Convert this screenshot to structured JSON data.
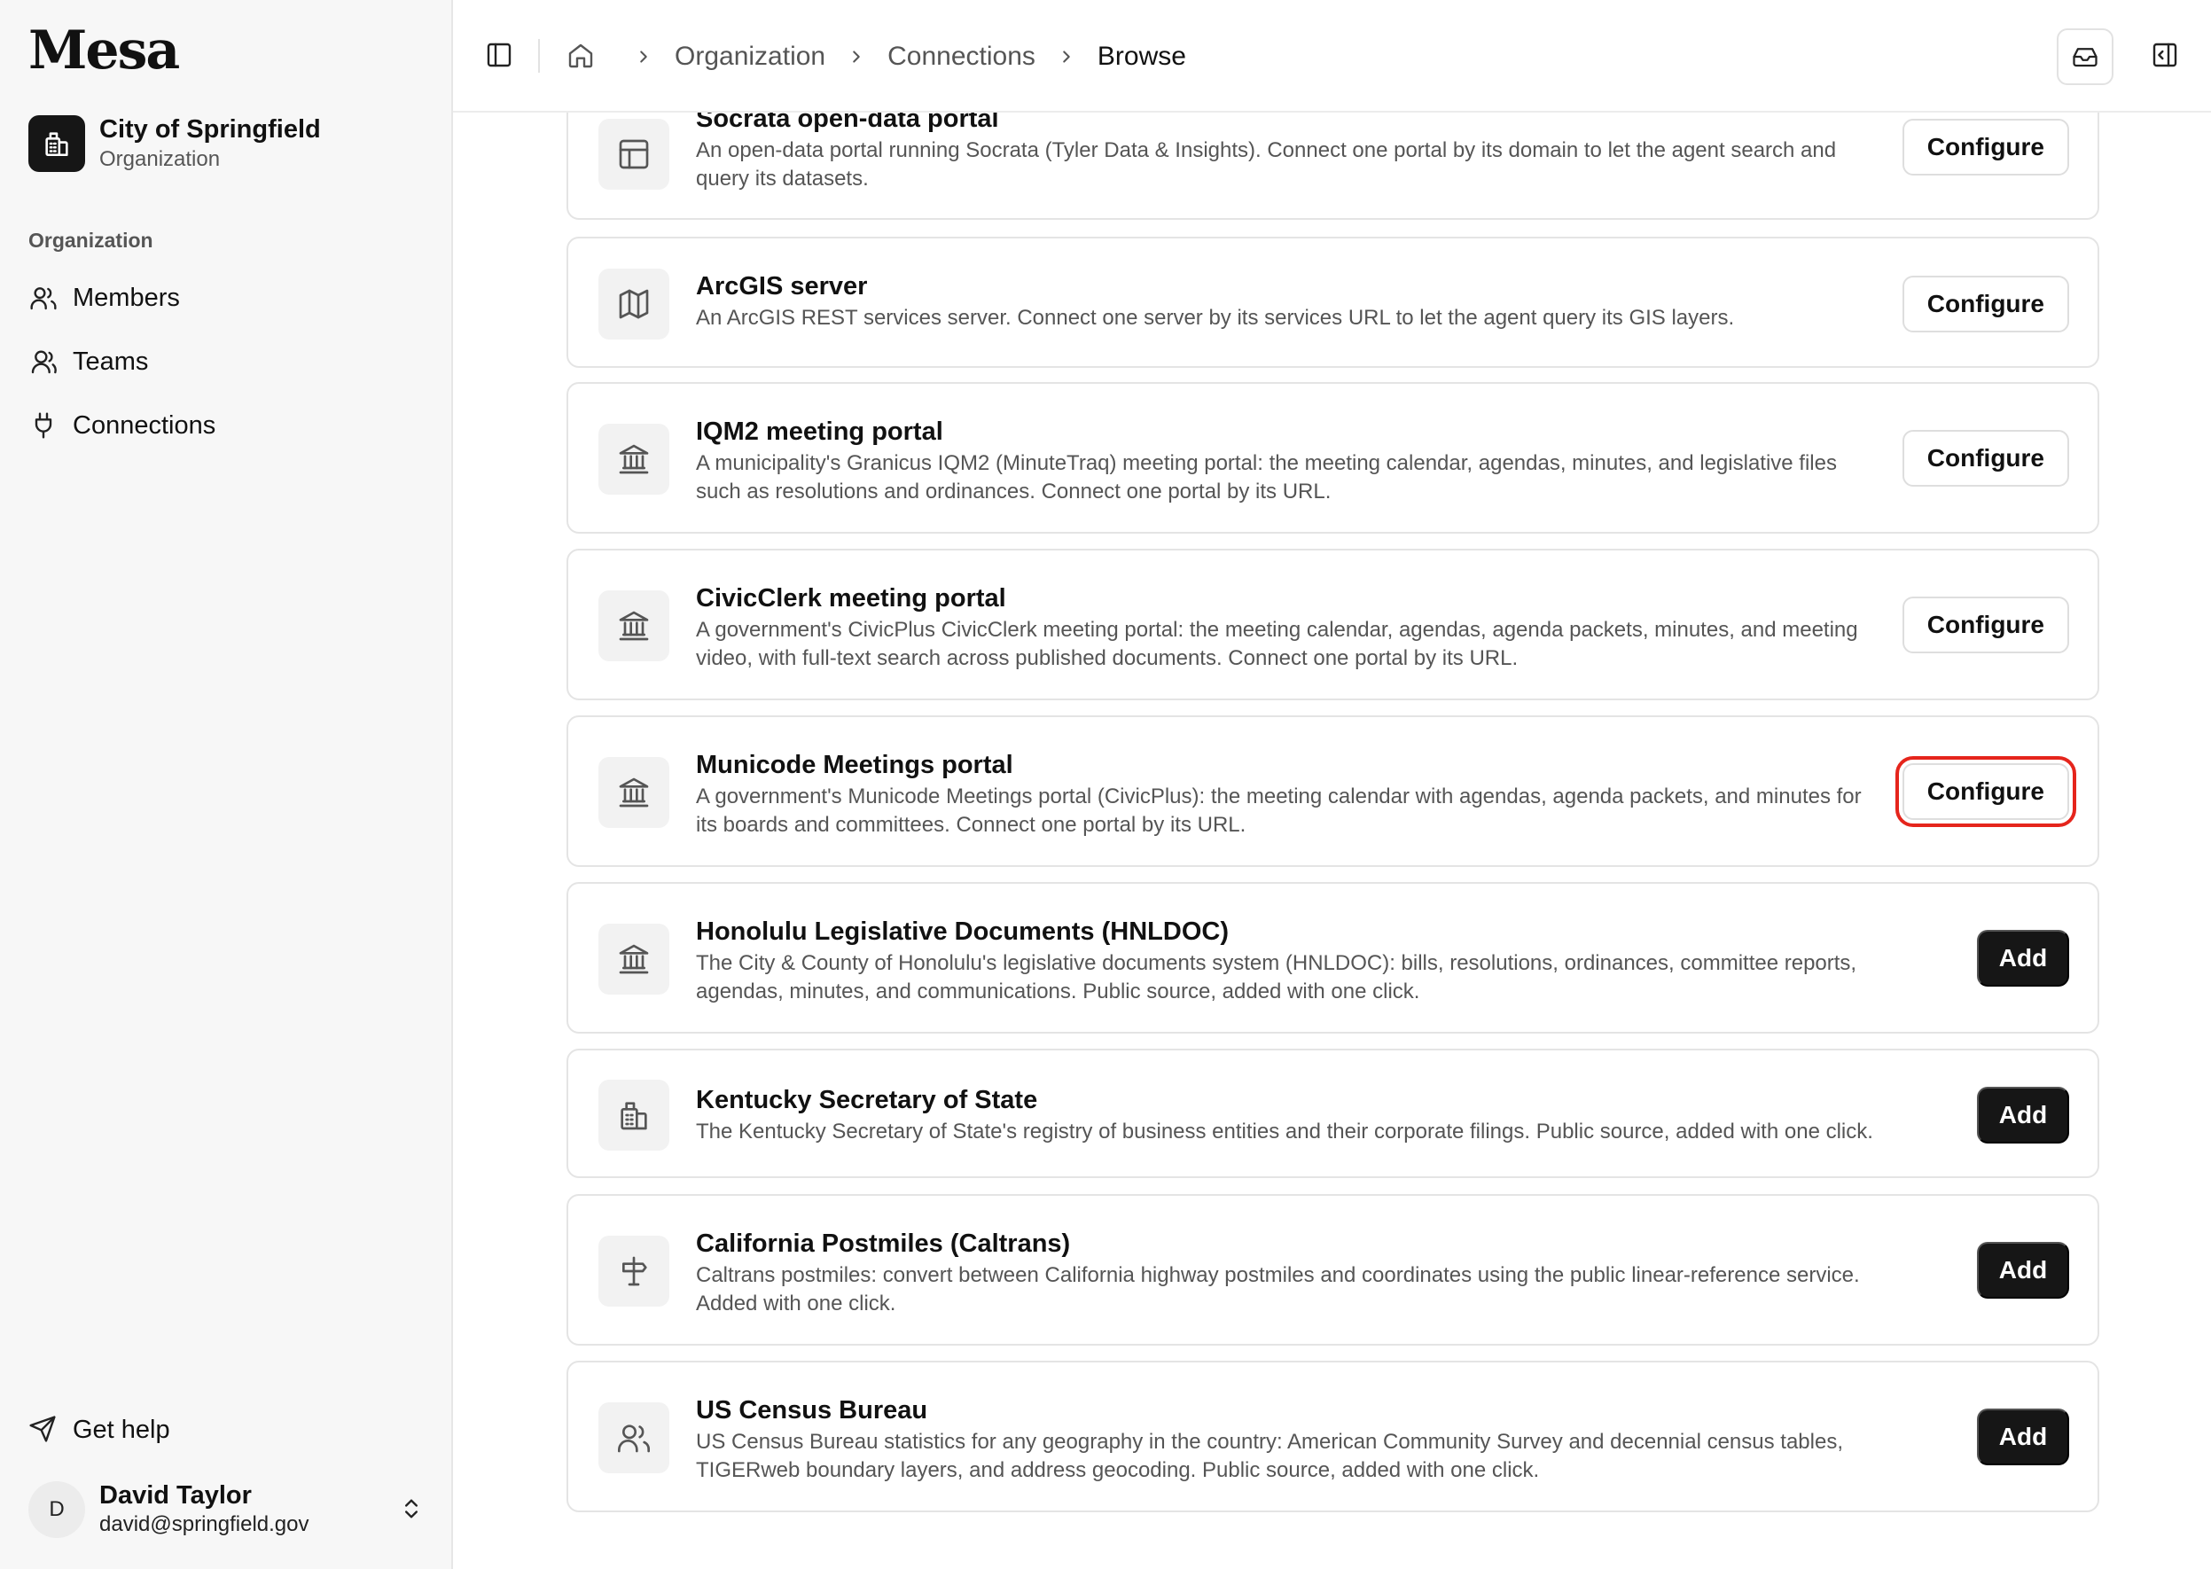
{
  "app": {
    "logo": "Mesa"
  },
  "org": {
    "name": "City of Springfield",
    "type": "Organization"
  },
  "sidebar": {
    "section_label": "Organization",
    "items": [
      {
        "label": "Members",
        "icon": "users-icon"
      },
      {
        "label": "Teams",
        "icon": "team-icon"
      },
      {
        "label": "Connections",
        "icon": "plug-icon"
      }
    ],
    "help_label": "Get help"
  },
  "user": {
    "initial": "D",
    "name": "David Taylor",
    "email": "david@springfield.gov"
  },
  "breadcrumb": {
    "items": [
      "Organization",
      "Connections"
    ],
    "current": "Browse"
  },
  "cards": [
    {
      "title": "Socrata open-data portal",
      "desc": "An open-data portal running Socrata (Tyler Data & Insights). Connect one portal by its domain to let the agent search and query its datasets.",
      "icon": "table-icon",
      "action": "Configure"
    },
    {
      "title": "ArcGIS server",
      "desc": "An ArcGIS REST services server. Connect one server by its services URL to let the agent query its GIS layers.",
      "icon": "map-icon",
      "action": "Configure"
    },
    {
      "title": "IQM2 meeting portal",
      "desc": "A municipality's Granicus IQM2 (MinuteTraq) meeting portal: the meeting calendar, agendas, minutes, and legislative files such as resolutions and ordinances. Connect one portal by its URL.",
      "icon": "landmark-icon",
      "action": "Configure"
    },
    {
      "title": "CivicClerk meeting portal",
      "desc": "A government's CivicPlus CivicClerk meeting portal: the meeting calendar, agendas, agenda packets, minutes, and meeting video, with full-text search across published documents. Connect one portal by its URL.",
      "icon": "landmark-icon",
      "action": "Configure"
    },
    {
      "title": "Municode Meetings portal",
      "desc": "A government's Municode Meetings portal (CivicPlus): the meeting calendar with agendas, agenda packets, and minutes for its boards and committees. Connect one portal by its URL.",
      "icon": "landmark-icon",
      "action": "Configure",
      "highlighted": true
    },
    {
      "title": "Honolulu Legislative Documents (HNLDOC)",
      "desc": "The City & County of Honolulu's legislative documents system (HNLDOC): bills, resolutions, ordinances, committee reports, agendas, minutes, and communications. Public source, added with one click.",
      "icon": "landmark-icon",
      "action": "Add"
    },
    {
      "title": "Kentucky Secretary of State",
      "desc": "The Kentucky Secretary of State's registry of business entities and their corporate filings. Public source, added with one click.",
      "icon": "building-icon",
      "action": "Add"
    },
    {
      "title": "California Postmiles (Caltrans)",
      "desc": "Caltrans postmiles: convert between California highway postmiles and coordinates using the public linear-reference service. Added with one click.",
      "icon": "signpost-icon",
      "action": "Add"
    },
    {
      "title": "US Census Bureau",
      "desc": "US Census Bureau statistics for any geography in the country: American Community Survey and decennial census tables, TIGERweb boundary layers, and address geocoding. Public source, added with one click.",
      "icon": "users-icon",
      "action": "Add"
    }
  ]
}
